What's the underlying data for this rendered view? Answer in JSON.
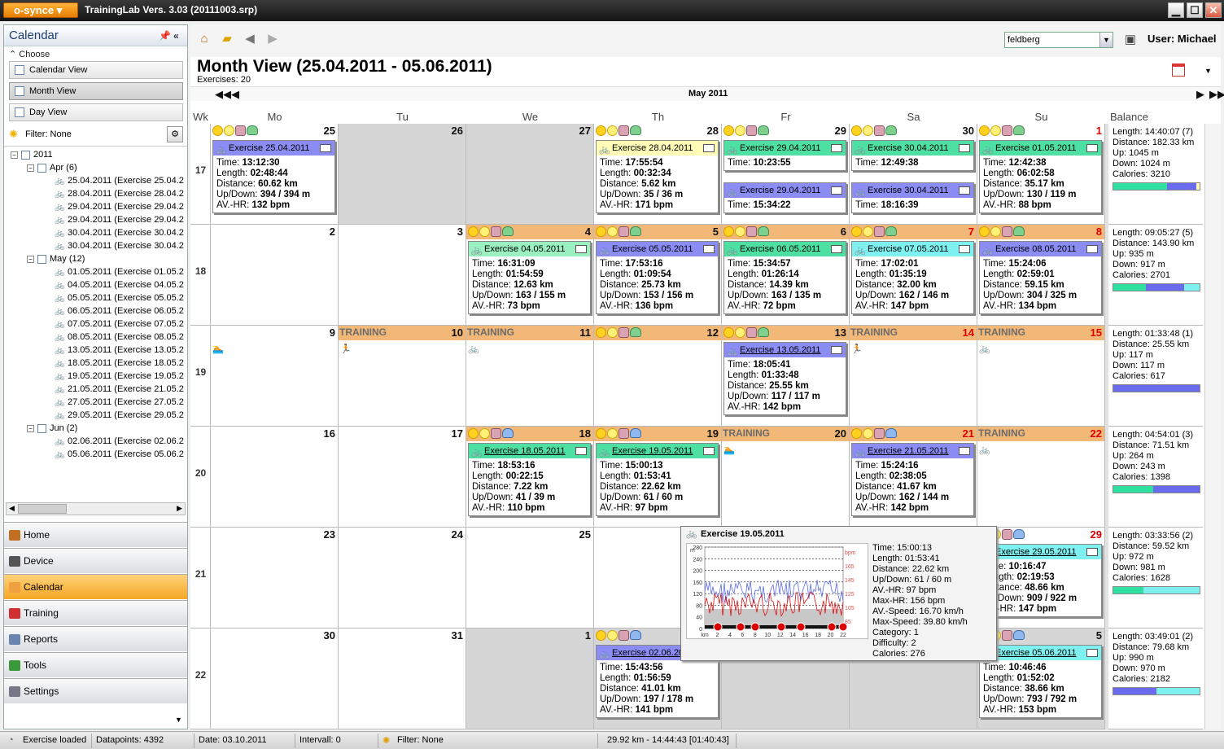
{
  "app": {
    "logo": "o-synce",
    "title": "TrainingLab Vers. 3.03 (20111003.srp)"
  },
  "window_buttons": {
    "minimize": "▁",
    "maximize": "☐",
    "close": "✕"
  },
  "left": {
    "title": "Calendar",
    "choose": "Choose",
    "views": [
      "Calendar View",
      "Month View",
      "Day View"
    ],
    "filter": "Filter: None",
    "tree": {
      "year": "2011",
      "apr": "Apr (6)",
      "apr_items": [
        "25.04.2011 (Exercise 25.04.2",
        "28.04.2011 (Exercise 28.04.2",
        "29.04.2011 (Exercise 29.04.2",
        "29.04.2011 (Exercise 29.04.2",
        "30.04.2011 (Exercise 30.04.2",
        "30.04.2011 (Exercise 30.04.2"
      ],
      "may": "May (12)",
      "may_items": [
        "01.05.2011 (Exercise 01.05.2",
        "04.05.2011 (Exercise 04.05.2",
        "05.05.2011 (Exercise 05.05.2",
        "06.05.2011 (Exercise 06.05.2",
        "07.05.2011 (Exercise 07.05.2",
        "08.05.2011 (Exercise 08.05.2",
        "13.05.2011 (Exercise 13.05.2",
        "18.05.2011 (Exercise 18.05.2",
        "19.05.2011 (Exercise 19.05.2",
        "21.05.2011 (Exercise 21.05.2",
        "27.05.2011 (Exercise 27.05.2",
        "29.05.2011 (Exercise 29.05.2"
      ],
      "jun": "Jun (2)",
      "jun_items": [
        "02.06.2011 (Exercise 02.06.2",
        "05.06.2011 (Exercise 05.06.2"
      ]
    },
    "nav": [
      "Home",
      "Device",
      "Calendar",
      "Training",
      "Reports",
      "Tools",
      "Settings"
    ]
  },
  "toolbar": {
    "view_select": "feldberg",
    "user": "User: Michael"
  },
  "main": {
    "title": "Month View (25.04.2011 - 05.06.2011)",
    "exercises": "Exercises: 20",
    "month": "May 2011",
    "headers": {
      "wk": "Wk",
      "days": [
        "Mo",
        "Tu",
        "We",
        "Th",
        "Fr",
        "Sa",
        "Su"
      ],
      "balance": "Balance"
    }
  },
  "weeks": [
    {
      "wk": "17",
      "days": [
        {
          "d": "25",
          "icons": "sun,smile,thumb,heart",
          "ex": [
            {
              "title": "Exercise 25.04.2011",
              "color": "c-blue",
              "lines": [
                "Time: ",
                "13:12:30",
                "Length: ",
                "02:48:44",
                "Distance: ",
                "60.62 km",
                "Up/Down: ",
                "394 / 394 m",
                "AV.-HR: ",
                "132 bpm"
              ]
            }
          ]
        },
        {
          "d": "26",
          "grey": true
        },
        {
          "d": "27",
          "grey": true
        },
        {
          "d": "28",
          "icons": "sun,smile,thumb,heart",
          "ex": [
            {
              "title": "Exercise 28.04.2011",
              "color": "c-yellow",
              "lines": [
                "Time: ",
                "17:55:54",
                "Length: ",
                "00:32:34",
                "Distance: ",
                "5.62 km",
                "Up/Down: ",
                "35 / 36 m",
                "AV.-HR: ",
                "171 bpm"
              ]
            }
          ]
        },
        {
          "d": "29",
          "icons": "sun,smile,thumb,heart",
          "ex": [
            {
              "title": "Exercise 29.04.2011",
              "color": "c-green",
              "lines": [
                "Time: ",
                "10:23:55"
              ]
            },
            {
              "title": "Exercise 29.04.2011",
              "color": "c-blue",
              "lines": [
                "Time: ",
                "15:34:22"
              ]
            }
          ]
        },
        {
          "d": "30",
          "icons": "sun,smile,thumb,heart",
          "ex": [
            {
              "title": "Exercise 30.04.2011",
              "color": "c-green",
              "lines": [
                "Time: ",
                "12:49:38"
              ]
            },
            {
              "title": "Exercise 30.04.2011",
              "color": "c-blue",
              "lines": [
                "Time: ",
                "18:16:39"
              ]
            }
          ]
        },
        {
          "d": "1",
          "red": true,
          "icons": "sun,smile,thumb,heart",
          "ex": [
            {
              "title": "Exercise 01.05.2011",
              "color": "c-green",
              "lines": [
                "Time: ",
                "12:42:38",
                "Length: ",
                "06:02:58",
                "Distance: ",
                "35.17 km",
                "Up/Down: ",
                "130 / 119 m",
                "AV.-HR: ",
                "88 bpm"
              ]
            }
          ]
        }
      ],
      "balance": [
        "Length: 14:40:07 (7)",
        "Distance: 182.33 km",
        "Up: 1045 m",
        "Down: 1024 m",
        "Calories: 3210"
      ],
      "bar": [
        {
          "c": "#2fe0a0",
          "w": 0.62
        },
        {
          "c": "#6b6bee",
          "w": 0.34
        },
        {
          "c": "#fffcb8",
          "w": 0.04
        }
      ]
    },
    {
      "wk": "18",
      "days": [
        {
          "d": "2"
        },
        {
          "d": "3"
        },
        {
          "d": "4",
          "tr": true,
          "icons": "sun,smile,thumb,heart",
          "ex": [
            {
              "title": "Exercise 04.05.2011",
              "color": "c-lgreen",
              "lines": [
                "Time: ",
                "16:31:09",
                "Length: ",
                "01:54:59",
                "Distance: ",
                "12.63 km",
                "Up/Down: ",
                "163 / 155 m",
                "AV.-HR: ",
                "73 bpm"
              ]
            }
          ]
        },
        {
          "d": "5",
          "tr": true,
          "icons": "sun,smile,thumb,heart",
          "ex": [
            {
              "title": "Exercise 05.05.2011",
              "color": "c-blue",
              "lines": [
                "Time: ",
                "17:53:16",
                "Length: ",
                "01:09:54",
                "Distance: ",
                "25.73 km",
                "Up/Down: ",
                "153 / 156 m",
                "AV.-HR: ",
                "136 bpm"
              ]
            }
          ]
        },
        {
          "d": "6",
          "tr": true,
          "icons": "sun,smile,thumb,heart",
          "ex": [
            {
              "title": "Exercise 06.05.2011",
              "color": "c-green",
              "lines": [
                "Time: ",
                "15:34:57",
                "Length: ",
                "01:26:14",
                "Distance: ",
                "14.39 km",
                "Up/Down: ",
                "163 / 135 m",
                "AV.-HR: ",
                "72 bpm"
              ]
            }
          ]
        },
        {
          "d": "7",
          "red": true,
          "tr": true,
          "icons": "sun,smile,thumb,heart",
          "ex": [
            {
              "title": "Exercise 07.05.2011",
              "color": "c-cyan",
              "lines": [
                "Time: ",
                "17:02:01",
                "Length: ",
                "01:35:19",
                "Distance: ",
                "32.00 km",
                "Up/Down: ",
                "162 / 146 m",
                "AV.-HR: ",
                "147 bpm"
              ]
            }
          ]
        },
        {
          "d": "8",
          "red": true,
          "tr": true,
          "icons": "sun,smile,thumb,heart",
          "ex": [
            {
              "title": "Exercise 08.05.2011",
              "color": "c-blue",
              "lines": [
                "Time: ",
                "15:24:06",
                "Length: ",
                "02:59:01",
                "Distance: ",
                "59.15 km",
                "Up/Down: ",
                "304 / 325 m",
                "AV.-HR: ",
                "134 bpm"
              ]
            }
          ]
        }
      ],
      "balance": [
        "Length: 09:05:27 (5)",
        "Distance: 143.90 km",
        "Up: 935 m",
        "Down: 917 m",
        "Calories: 2701"
      ],
      "bar": [
        {
          "c": "#2fe0a0",
          "w": 0.38
        },
        {
          "c": "#6b6bee",
          "w": 0.44
        },
        {
          "c": "#7ff0f0",
          "w": 0.18
        }
      ]
    },
    {
      "wk": "19",
      "days": [
        {
          "d": "9",
          "act": "🏊"
        },
        {
          "d": "10",
          "tr": true,
          "label": "TRAINING",
          "act": "🏃"
        },
        {
          "d": "11",
          "tr": true,
          "label": "TRAINING",
          "act": "🚲"
        },
        {
          "d": "12",
          "tr": true,
          "icons": "sun,smile,thumb,heart"
        },
        {
          "d": "13",
          "tr": true,
          "icons": "sun,smile,thumb,heart",
          "ex": [
            {
              "title": "Exercise 13.05.2011",
              "color": "c-blue",
              "u": true,
              "lines": [
                "Time: ",
                "18:05:41",
                "Length: ",
                "01:33:48",
                "Distance: ",
                "25.55 km",
                "Up/Down: ",
                "117 / 117 m",
                "AV.-HR: ",
                "142 bpm"
              ]
            }
          ]
        },
        {
          "d": "14",
          "red": true,
          "tr": true,
          "label": "TRAINING",
          "act": "🏃"
        },
        {
          "d": "15",
          "red": true,
          "tr": true,
          "label": "TRAINING",
          "act": "🚲"
        }
      ],
      "balance": [
        "Length: 01:33:48 (1)",
        "Distance: 25.55 km",
        "Up: 117 m",
        "Down: 117 m",
        "Calories: 617"
      ],
      "bar": [
        {
          "c": "#6b6bee",
          "w": 1
        }
      ]
    },
    {
      "wk": "20",
      "days": [
        {
          "d": "16"
        },
        {
          "d": "17"
        },
        {
          "d": "18",
          "tr": true,
          "icons": "sun,smile,thumb,heartb",
          "ex": [
            {
              "title": "Exercise 18.05.2011",
              "color": "c-green",
              "u": true,
              "lines": [
                "Time: ",
                "18:53:16",
                "Length: ",
                "00:22:15",
                "Distance: ",
                "7.22 km",
                "Up/Down: ",
                "41 / 39 m",
                "AV.-HR: ",
                "110 bpm"
              ]
            }
          ]
        },
        {
          "d": "19",
          "tr": true,
          "icons": "sun,smile,thumb,heartb",
          "ex": [
            {
              "title": "Exercise 19.05.2011",
              "color": "c-green",
              "u": true,
              "lines": [
                "Time: ",
                "15:00:13",
                "Length: ",
                "01:53:41",
                "Distance: ",
                "22.62 km",
                "Up/Down: ",
                "61 / 60 m",
                "AV.-HR: ",
                "97 bpm"
              ]
            }
          ]
        },
        {
          "d": "20",
          "tr": true,
          "label": "TRAINING",
          "act": "🏊"
        },
        {
          "d": "21",
          "red": true,
          "tr": true,
          "icons": "sun,smile,thumb,heartb",
          "ex": [
            {
              "title": "Exercise 21.05.2011",
              "color": "c-blue",
              "u": true,
              "lines": [
                "Time: ",
                "15:24:16",
                "Length: ",
                "02:38:05",
                "Distance: ",
                "41.67 km",
                "Up/Down: ",
                "162 / 144 m",
                "AV.-HR: ",
                "142 bpm"
              ]
            }
          ]
        },
        {
          "d": "22",
          "red": true,
          "tr": true,
          "label": "TRAINING",
          "act": "🚲"
        }
      ],
      "balance": [
        "Length: 04:54:01 (3)",
        "Distance: 71.51 km",
        "Up: 264 m",
        "Down: 243 m",
        "Calories: 1398"
      ],
      "bar": [
        {
          "c": "#2fe0a0",
          "w": 0.46
        },
        {
          "c": "#6b6bee",
          "w": 0.54
        }
      ]
    },
    {
      "wk": "21",
      "days": [
        {
          "d": "23"
        },
        {
          "d": "24"
        },
        {
          "d": "25"
        },
        {
          "d": ""
        },
        {
          "d": ""
        },
        {
          "d": ""
        },
        {
          "d": "29",
          "red": true,
          "icons": "sun,smile,thumb,heartb",
          "ex": [
            {
              "title": "Exercise 29.05.2011",
              "color": "c-cyan",
              "u": true,
              "lines": [
                "Time: ",
                "10:16:47",
                "Length: ",
                "02:19:53",
                "Distance: ",
                "48.66 km",
                "Up/Down: ",
                "909 / 922 m",
                "AV.-HR: ",
                "147 bpm"
              ]
            }
          ]
        }
      ],
      "balance": [
        "Length: 03:33:56 (2)",
        "Distance: 59.52 km",
        "Up: 972 m",
        "Down: 981 m",
        "Calories: 1628"
      ],
      "bar": [
        {
          "c": "#2fe0a0",
          "w": 0.35
        },
        {
          "c": "#7ff0f0",
          "w": 0.65
        }
      ]
    },
    {
      "wk": "22",
      "days": [
        {
          "d": "30"
        },
        {
          "d": "31"
        },
        {
          "d": "1",
          "grey": true
        },
        {
          "d": "2",
          "grey": true,
          "icons": "sun,smile,thumb,heartb",
          "ex": [
            {
              "title": "Exercise 02.06.2011",
              "color": "c-blue",
              "u": true,
              "lines": [
                "Time: ",
                "15:43:56",
                "Length: ",
                "01:56:59",
                "Distance: ",
                "41.01 km",
                "Up/Down: ",
                "197 / 178 m",
                "AV.-HR: ",
                "141 bpm"
              ]
            }
          ]
        },
        {
          "d": "",
          "grey": true
        },
        {
          "d": "",
          "grey": true
        },
        {
          "d": "5",
          "grey": true,
          "icons": "sun,smile,thumb,heartb",
          "ex": [
            {
              "title": "Exercise 05.06.2011",
              "color": "c-cyan",
              "u": true,
              "lines": [
                "Time: ",
                "10:46:46",
                "Length: ",
                "01:52:02",
                "Distance: ",
                "38.66 km",
                "Up/Down: ",
                "793 / 792 m",
                "AV.-HR: ",
                "153 bpm"
              ]
            }
          ]
        }
      ],
      "balance": [
        "Length: 03:49:01 (2)",
        "Distance: 79.68 km",
        "Up: 990 m",
        "Down: 970 m",
        "Calories: 2182"
      ],
      "bar": [
        {
          "c": "#6b6bee",
          "w": 0.5
        },
        {
          "c": "#7ff0f0",
          "w": 0.5
        }
      ]
    }
  ],
  "popup": {
    "title": "Exercise 19.05.2011",
    "values": [
      "Time: 15:00:13",
      "Length: 01:53:41",
      "Distance: 22.62 km",
      "Up/Down: 61 / 60 m",
      "AV.-HR: 97 bpm",
      "Max-HR: 156 bpm",
      "AV.-Speed: 16.70 km/h",
      "Max-Speed: 39.80 km/h",
      "Category: 1",
      "Difficulty: 2",
      "Calories: 276"
    ],
    "yaxis": [
      "280",
      "240",
      "200",
      "160",
      "120",
      "80",
      "40",
      "0"
    ],
    "y2axis": [
      "bpm",
      "165",
      "145",
      "125",
      "105",
      "85"
    ],
    "xaxis": [
      "km",
      "2",
      "4",
      "6",
      "8",
      "10",
      "12",
      "14",
      "16",
      "18",
      "20",
      "22"
    ],
    "ylabel": "m"
  },
  "status": {
    "loaded": "Exercise loaded",
    "datapoints": "Datapoints: 4392",
    "date": "Date: 03.10.2011",
    "interval": "Intervall: 0",
    "filter": "Filter: None",
    "summary": "29.92 km - 14:44:43 [01:40:43]"
  }
}
